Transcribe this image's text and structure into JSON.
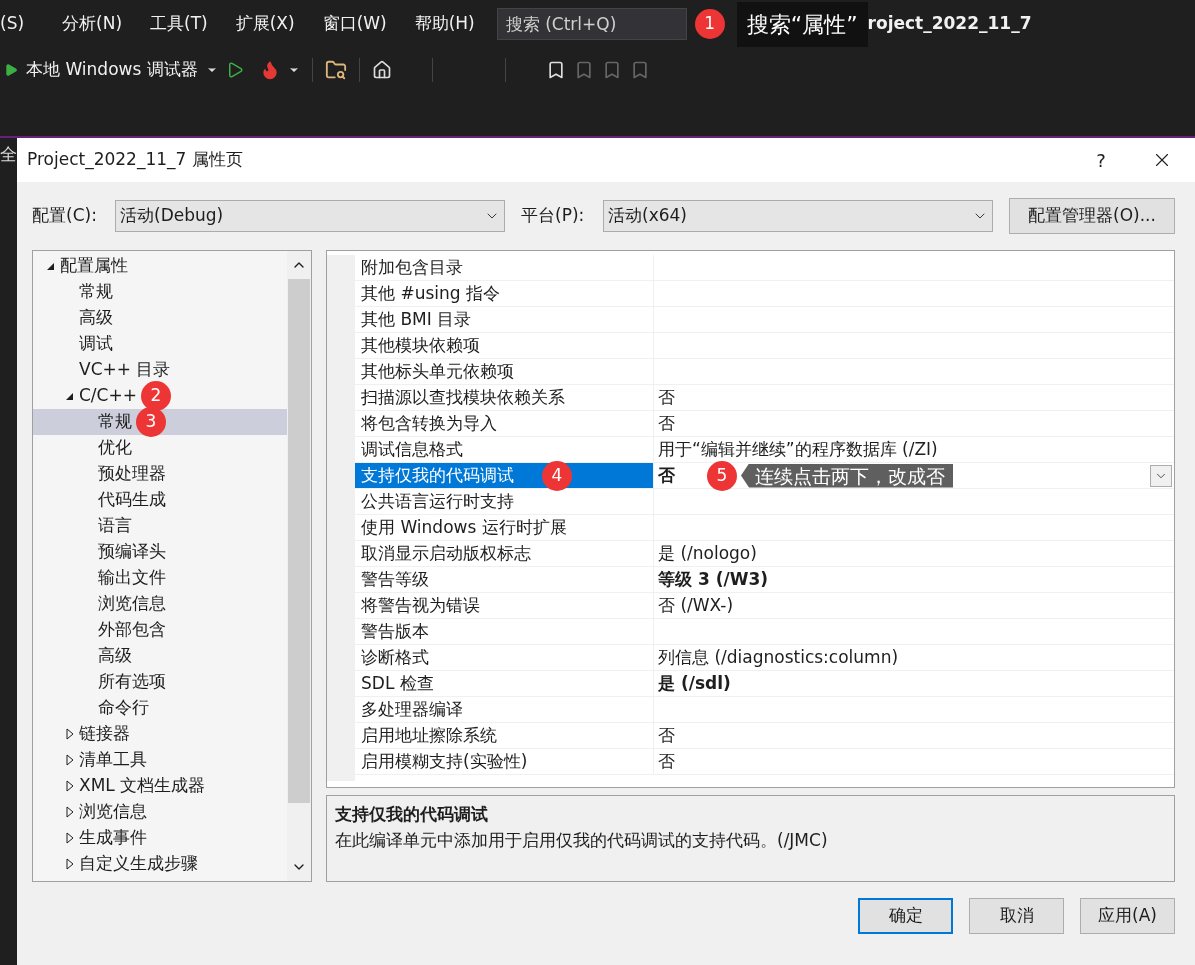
{
  "ide": {
    "menu": [
      "(S)",
      "分析(N)",
      "工具(T)",
      "扩展(X)",
      "窗口(W)",
      "帮助(H)"
    ],
    "search": {
      "placeholder": "搜索 (Ctrl+Q)",
      "badge": "1",
      "callout": "搜索“属性”"
    },
    "title": "roject_2022_11_7",
    "toolbar": {
      "debugger": "本地 Windows 调试器"
    },
    "editor_fragment": "全"
  },
  "dialog": {
    "title": "Project_2022_11_7 属性页",
    "help": "?",
    "config": {
      "label": "配置(C):",
      "value": "活动(Debug)"
    },
    "platform": {
      "label": "平台(P):",
      "value": "活动(x64)"
    },
    "manager_button": "配置管理器(O)...",
    "tree": [
      {
        "label": "配置属性",
        "expanded": true,
        "selected": false,
        "children": [
          {
            "label": "常规",
            "selected": false
          },
          {
            "label": "高级",
            "selected": false
          },
          {
            "label": "调试",
            "selected": false
          },
          {
            "label": "VC++ 目录",
            "selected": false
          },
          {
            "label": "C/C++",
            "expanded": true,
            "selected": false,
            "badge": "2",
            "children": [
              {
                "label": "常规",
                "selected": true,
                "badge": "3"
              },
              {
                "label": "优化",
                "selected": false
              },
              {
                "label": "预处理器",
                "selected": false
              },
              {
                "label": "代码生成",
                "selected": false
              },
              {
                "label": "语言",
                "selected": false
              },
              {
                "label": "预编译头",
                "selected": false
              },
              {
                "label": "输出文件",
                "selected": false
              },
              {
                "label": "浏览信息",
                "selected": false
              },
              {
                "label": "外部包含",
                "selected": false
              },
              {
                "label": "高级",
                "selected": false
              },
              {
                "label": "所有选项",
                "selected": false
              },
              {
                "label": "命令行",
                "selected": false
              }
            ]
          },
          {
            "label": "链接器",
            "expanded": false,
            "selected": false
          },
          {
            "label": "清单工具",
            "expanded": false,
            "selected": false
          },
          {
            "label": "XML 文档生成器",
            "expanded": false,
            "selected": false
          },
          {
            "label": "浏览信息",
            "expanded": false,
            "selected": false
          },
          {
            "label": "生成事件",
            "expanded": false,
            "selected": false
          },
          {
            "label": "自定义生成步骤",
            "expanded": false,
            "selected": false
          }
        ]
      }
    ],
    "properties": [
      {
        "name": "附加包含目录",
        "selected": false
      },
      {
        "name": "其他 #using 指令",
        "selected": false
      },
      {
        "name": "其他 BMI 目录",
        "selected": false
      },
      {
        "name": "其他模块依赖项",
        "selected": false
      },
      {
        "name": "其他标头单元依赖项",
        "selected": false
      },
      {
        "name": "扫描源以查找模块依赖关系",
        "value": "否",
        "bold": false,
        "selected": false
      },
      {
        "name": "将包含转换为导入",
        "value": "否",
        "bold": false,
        "selected": false
      },
      {
        "name": "调试信息格式",
        "value": "用于“编辑并继续”的程序数据库 (/ZI)",
        "bold": false,
        "selected": false
      },
      {
        "name": "支持仅我的代码调试",
        "value": "否",
        "bold": true,
        "selected": true,
        "badge": "4",
        "value_badge": "5",
        "callout": "连续点击两下，改成否"
      },
      {
        "name": "公共语言运行时支持",
        "selected": false
      },
      {
        "name": "使用 Windows 运行时扩展",
        "selected": false
      },
      {
        "name": "取消显示启动版权标志",
        "value": "是 (/nologo)",
        "bold": false,
        "selected": false
      },
      {
        "name": "警告等级",
        "value": "等级 3 (/W3)",
        "bold": true,
        "selected": false
      },
      {
        "name": "将警告视为错误",
        "value": "否 (/WX-)",
        "bold": false,
        "selected": false
      },
      {
        "name": "警告版本",
        "selected": false
      },
      {
        "name": "诊断格式",
        "value": "列信息 (/diagnostics:column)",
        "bold": false,
        "selected": false
      },
      {
        "name": "SDL 检查",
        "value": "是 (/sdl)",
        "bold": true,
        "selected": false
      },
      {
        "name": "多处理器编译",
        "selected": false
      },
      {
        "name": "启用地址擦除系统",
        "value": "否",
        "bold": false,
        "selected": false
      },
      {
        "name": "启用模糊支持(实验性)",
        "value": "否",
        "bold": false,
        "selected": false
      }
    ],
    "description": {
      "title": "支持仅我的代码调试",
      "text": "在此编译单元中添加用于启用仅我的代码调试的支持代码。(/JMC)"
    },
    "buttons": [
      "确定",
      "取消",
      "应用(A)"
    ]
  }
}
